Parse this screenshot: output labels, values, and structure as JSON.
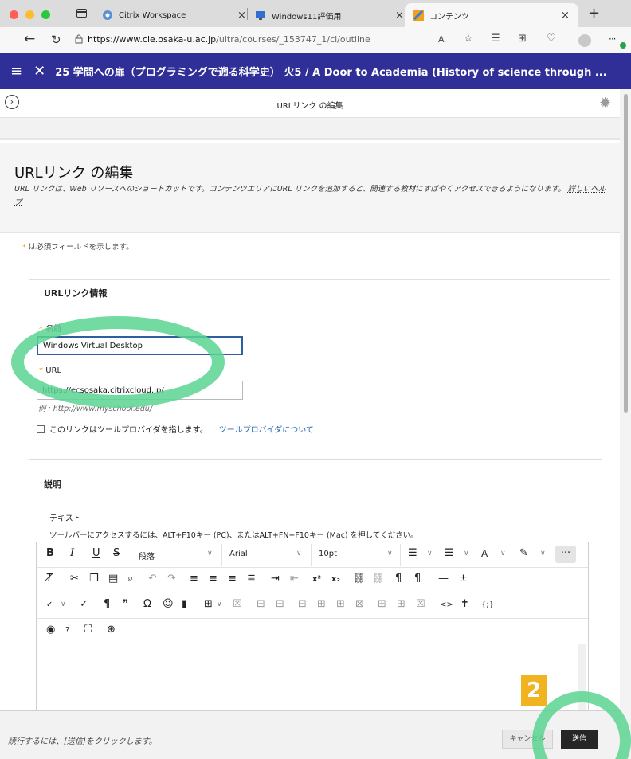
{
  "browser": {
    "tabs": [
      {
        "label": "Citrix Workspace",
        "icon": "citrix-icon",
        "active": false
      },
      {
        "label": "Windows11評価用",
        "icon": "monitor-icon",
        "active": false
      },
      {
        "label": "コンテンツ",
        "icon": "blackboard-icon",
        "active": true
      }
    ],
    "url_host": "https://www.cle.osaka-u.ac.jp",
    "url_path": "/ultra/courses/_153747_1/cl/outline",
    "new_tab": "+",
    "read_aloud": "A",
    "more": "···"
  },
  "course": {
    "title": "25 学問への扉（プログラミングで遡る科学史） 火5 / A Door to Academia (History of science through ..."
  },
  "panel": {
    "title": "URLリンク の編集"
  },
  "page": {
    "heading": "URLリンク の編集",
    "description": "URL リンクは、Web リソースへのショートカットです。コンテンツエリアにURL リンクを追加すると、関連する教材にすばやくアクセスできるようになります。",
    "help_link": "詳しいヘルプ",
    "required_note": "は必須フィールドを示します。",
    "required_star": "*"
  },
  "url_link_info": {
    "section_title": "URLリンク情報",
    "name_label": "名前",
    "name_value": "Windows Virtual Desktop",
    "url_label": "URL",
    "url_value": "https://ecsosaka.citrixcloud.jp/",
    "example": "例 : http://www.myschool.edu/",
    "tool_provider_checkbox": "このリンクはツールプロバイダを指します。",
    "tool_provider_link": "ツールプロバイダについて"
  },
  "description_section": {
    "title": "説明",
    "text_label": "テキスト",
    "keyboard_hint": "ツールバーにアクセスするには、ALT+F10キー (PC)、またはALT+FN+F10キー (Mac) を押してください。"
  },
  "editor_toolbar": {
    "bold": "B",
    "italic": "I",
    "underline": "U",
    "strikethrough": "S",
    "paragraph": "段落",
    "font": "Arial",
    "size": "10pt",
    "more": "···"
  },
  "footer": {
    "instruction": "続行するには、[送信]をクリックします。",
    "cancel": "キャンセル",
    "submit": "送信"
  },
  "annotation": {
    "step_number": "2",
    "highlight_color": "#5bd592",
    "badge_color": "#f2b320"
  },
  "colors": {
    "header_bg": "#2f2f97",
    "link": "#2767b0",
    "submit_bg": "#262626"
  }
}
